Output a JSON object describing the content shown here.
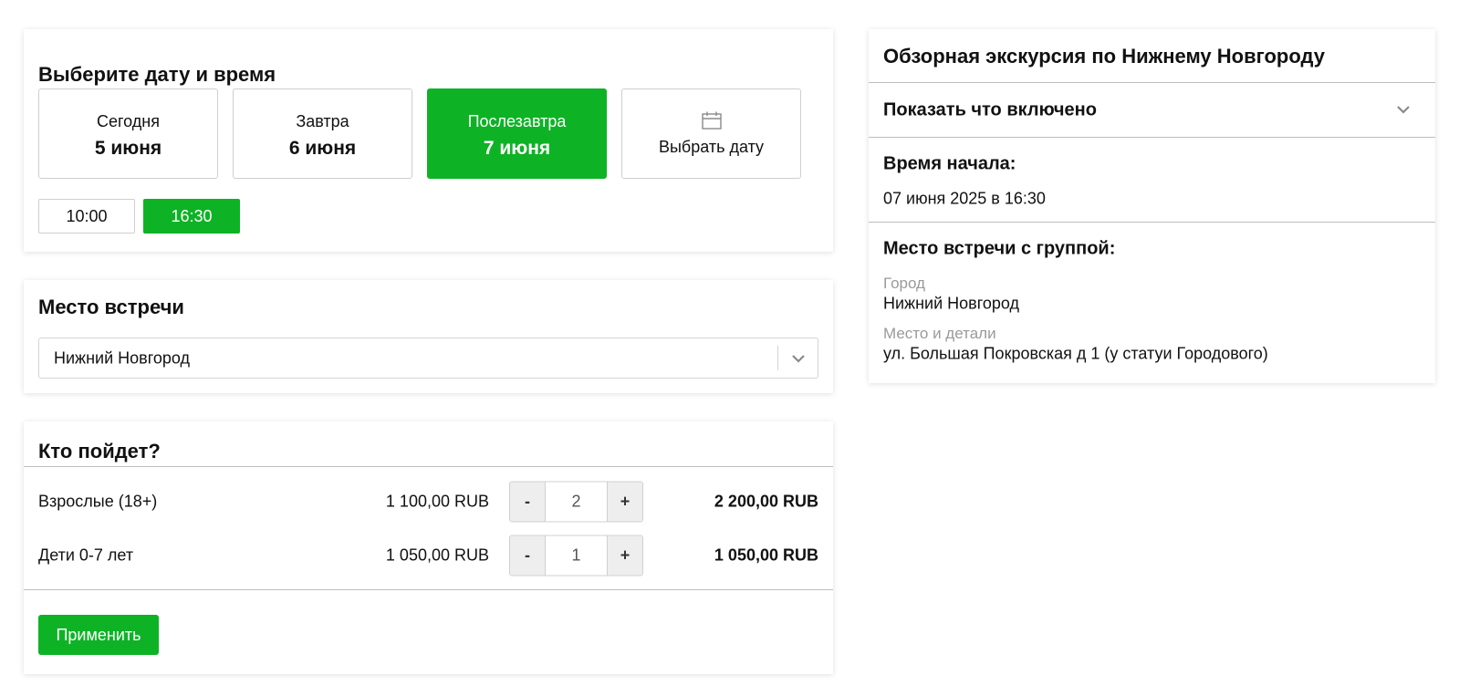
{
  "date_section": {
    "title": "Выберите дату и время",
    "tiles": [
      {
        "label": "Сегодня",
        "date": "5 июня",
        "selected": false
      },
      {
        "label": "Завтра",
        "date": "6 июня",
        "selected": false
      },
      {
        "label": "Послезавтра",
        "date": "7 июня",
        "selected": true
      },
      {
        "label": "Выбрать дату",
        "icon": "calendar-icon",
        "selected": false
      }
    ],
    "times": [
      {
        "label": "10:00",
        "selected": false
      },
      {
        "label": "16:30",
        "selected": true
      }
    ]
  },
  "place_section": {
    "title": "Место встречи",
    "selected_value": "Нижний Новгород",
    "dropdown_icon": "chevron-down-icon"
  },
  "who_section": {
    "title": "Кто пойдет?",
    "rows": [
      {
        "name": "Взрослые (18+)",
        "price": "1 100,00 RUB",
        "minus": "-",
        "count": "2",
        "plus": "+",
        "total": "2 200,00 RUB"
      },
      {
        "name": "Дети 0-7 лет",
        "price": "1 050,00 RUB",
        "minus": "-",
        "count": "1",
        "plus": "+",
        "total": "1 050,00 RUB"
      }
    ],
    "apply_label": "Применить"
  },
  "summary": {
    "title": "Обзорная экскурсия по Нижнему Новгороду",
    "included_label": "Показать что включено",
    "start_heading": "Время начала:",
    "start_value": "07 июня 2025 в 16:30",
    "meeting_heading": "Место встречи с группой:",
    "city_label": "Город",
    "city_value": "Нижний Новгород",
    "details_label": "Место и детали",
    "details_value": "ул. Большая Покровская д 1 (у статуи Городового)"
  },
  "colors": {
    "accent": "#0db325",
    "border": "#cfcfcf",
    "muted_text": "#9a9a9a"
  }
}
